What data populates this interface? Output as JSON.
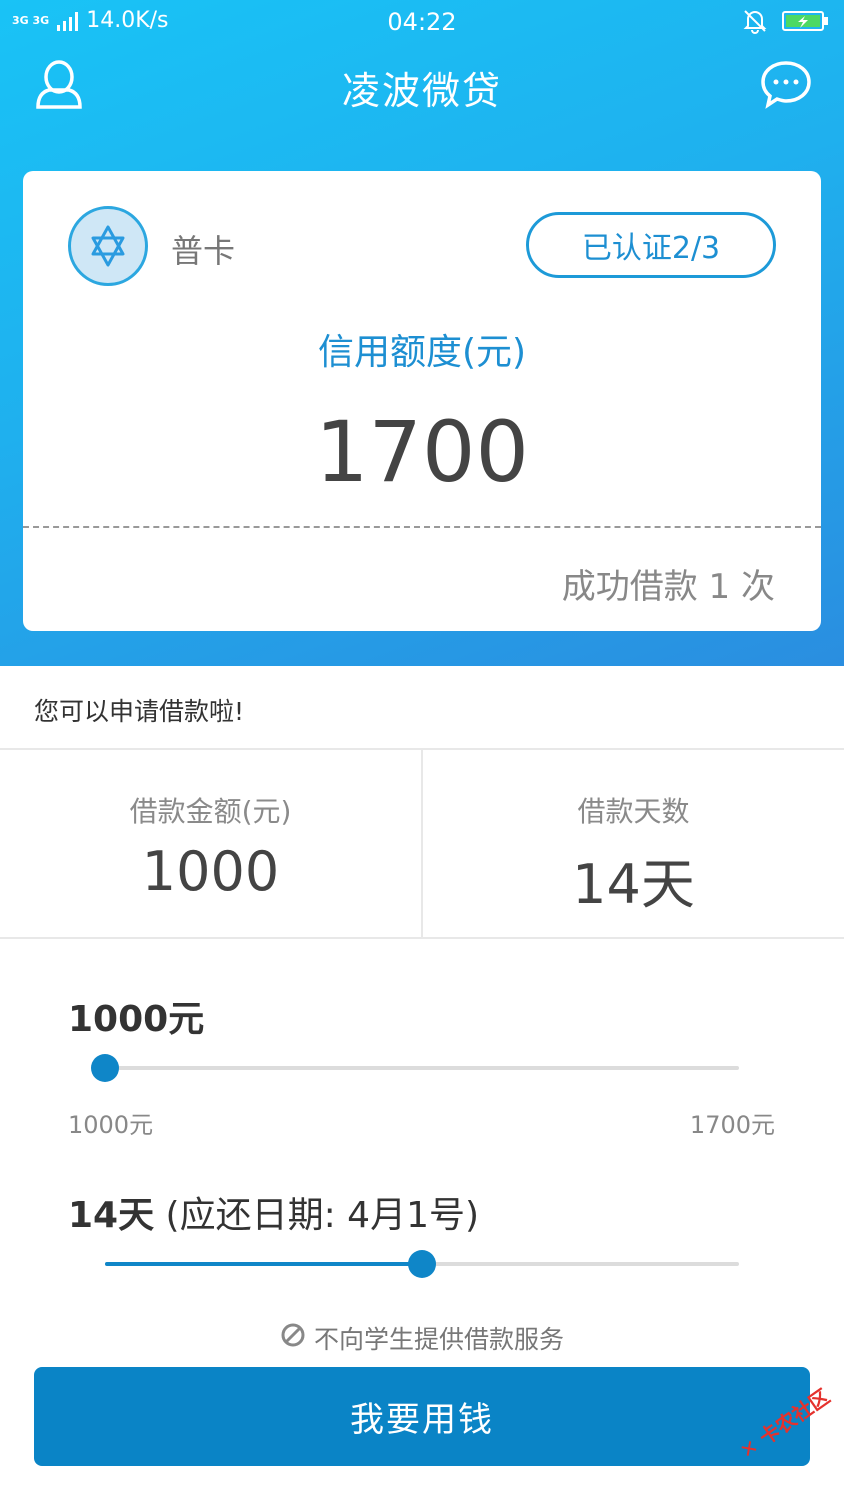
{
  "status_bar": {
    "network": "3G 3G",
    "speed": "14.0K/s",
    "time": "04:22",
    "icons": [
      "bell-off-icon",
      "battery-charging-icon"
    ]
  },
  "header": {
    "title": "凌波微贷",
    "left_icon": "user-profile-icon",
    "right_icon": "chat-message-icon"
  },
  "card": {
    "level_icon": "star-badge-icon",
    "level_name": "普卡",
    "verify_button": "已认证2/3",
    "credit_label": "信用额度(元)",
    "credit_amount": "1700",
    "loan_count": "成功借款 1 次"
  },
  "notice": "您可以申请借款啦!",
  "loan_amount": {
    "label": "借款金额(元)",
    "value": "1000"
  },
  "loan_days": {
    "label": "借款天数",
    "value": "14天"
  },
  "amount_slider": {
    "title": "1000元",
    "min_label": "1000元",
    "max_label": "1700元",
    "position": 0
  },
  "days_slider": {
    "title_bold": "14天",
    "title_rest": " (应还日期: 4月1号)",
    "position": 0.5
  },
  "student_note": "不向学生提供借款服务",
  "submit_button": "我要用钱",
  "watermark": "卡农社区",
  "colors": {
    "primary": "#0a84c6",
    "accent": "#1d8fd2",
    "hero_start": "#19c3f6",
    "hero_end": "#2a8ee0"
  }
}
